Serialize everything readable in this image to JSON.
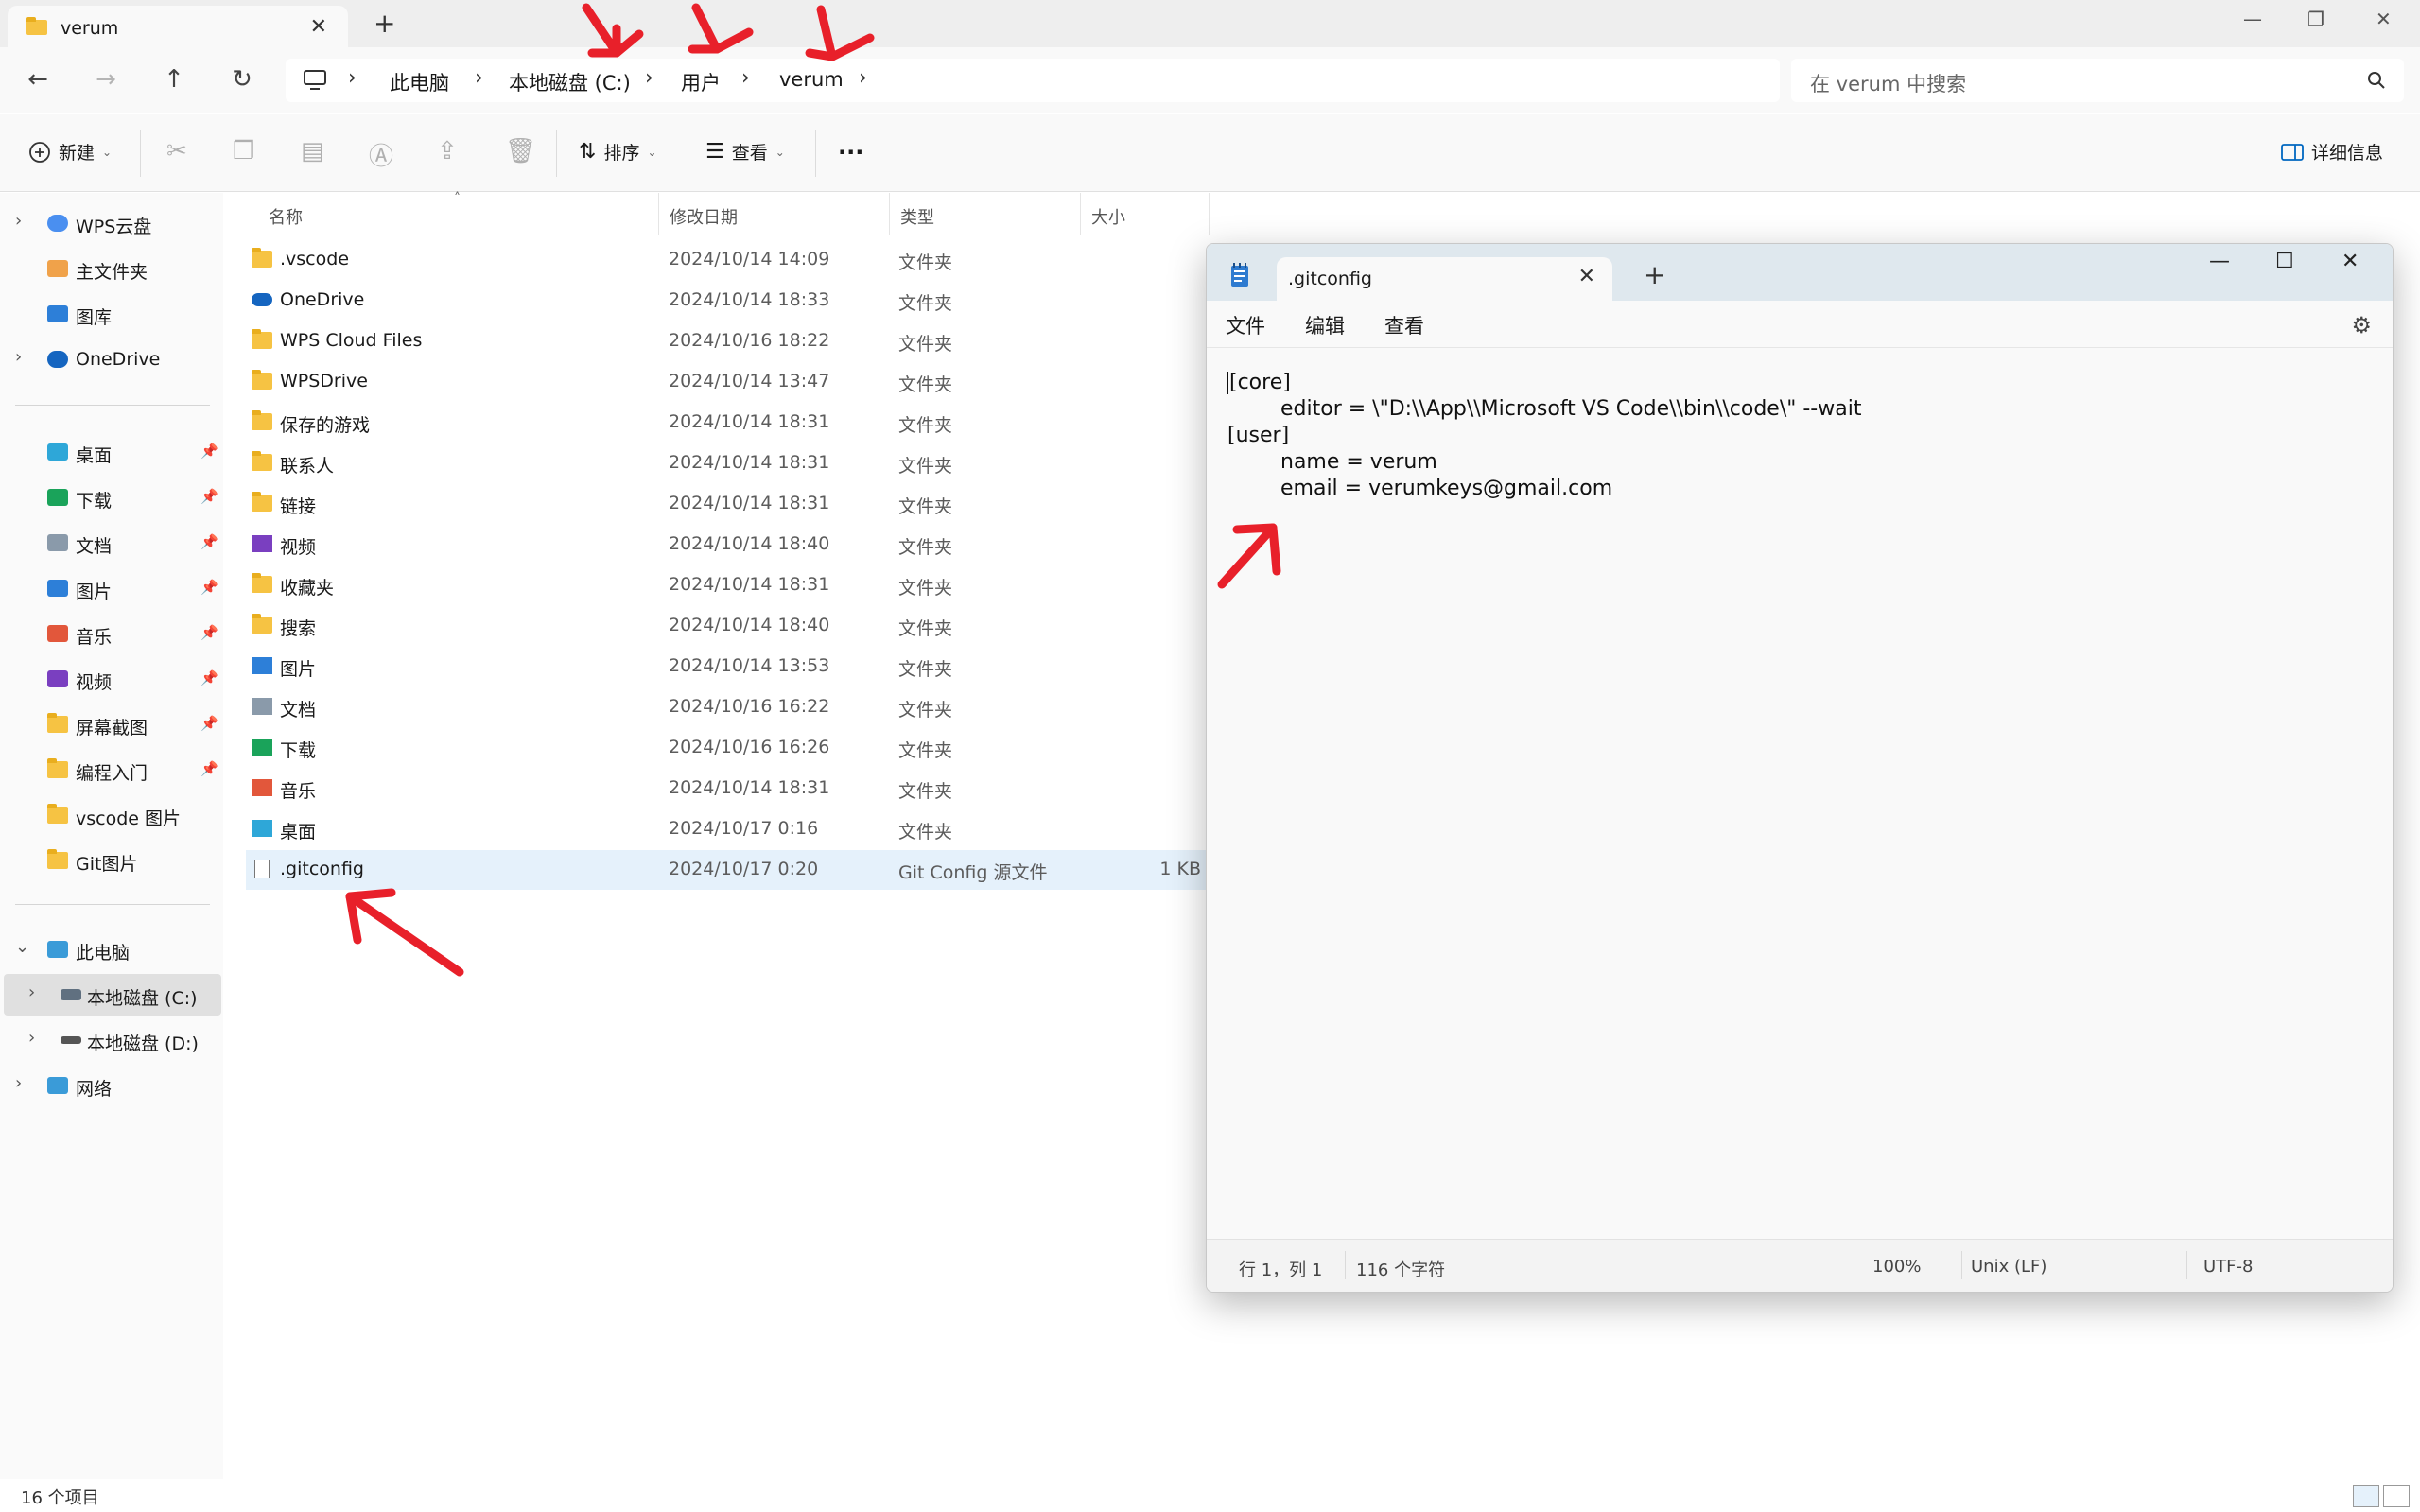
{
  "window": {
    "tab_title": "verum",
    "tab_close": "✕",
    "new_tab": "+",
    "minimize": "—",
    "restore": "❐",
    "close": "✕"
  },
  "nav": {
    "back": "←",
    "forward": "→",
    "up": "↑",
    "refresh": "↻"
  },
  "breadcrumb": [
    "此电脑",
    "本地磁盘 (C:)",
    "用户",
    "verum"
  ],
  "search": {
    "placeholder": "在 verum 中搜索"
  },
  "commandbar": {
    "new_label": "新建",
    "sort_label": "排序",
    "view_label": "查看",
    "more": "···",
    "details_label": "详细信息"
  },
  "sidebar": {
    "top": [
      {
        "label": "WPS云盘",
        "expand": true,
        "icon": "cloud-icon"
      },
      {
        "label": "主文件夹",
        "expand": false,
        "icon": "home-icon"
      },
      {
        "label": "图库",
        "expand": false,
        "icon": "gallery-icon"
      },
      {
        "label": "OneDrive",
        "expand": true,
        "icon": "onedrive-icon"
      }
    ],
    "quick": [
      {
        "label": "桌面",
        "icon": "desktop-icon",
        "pinned": true
      },
      {
        "label": "下载",
        "icon": "download-icon",
        "pinned": true
      },
      {
        "label": "文档",
        "icon": "document-icon",
        "pinned": true
      },
      {
        "label": "图片",
        "icon": "picture-icon",
        "pinned": true
      },
      {
        "label": "音乐",
        "icon": "music-icon",
        "pinned": true
      },
      {
        "label": "视频",
        "icon": "video-icon",
        "pinned": true
      },
      {
        "label": "屏幕截图",
        "icon": "folder-icon",
        "pinned": true
      },
      {
        "label": "编程入门",
        "icon": "folder-icon",
        "pinned": true
      },
      {
        "label": "vscode 图片",
        "icon": "folder-icon",
        "pinned": false
      },
      {
        "label": "Git图片",
        "icon": "folder-icon",
        "pinned": false
      }
    ],
    "pc": {
      "label": "此电脑"
    },
    "drive_c": {
      "label": "本地磁盘 (C:)"
    },
    "drive_d": {
      "label": "本地磁盘 (D:)"
    },
    "network": {
      "label": "网络"
    }
  },
  "columns": {
    "name": "名称",
    "modified": "修改日期",
    "type": "类型",
    "size": "大小"
  },
  "files": [
    {
      "name": ".vscode",
      "date": "2024/10/14 14:09",
      "type": "文件夹",
      "size": "",
      "icon": "folder-icon"
    },
    {
      "name": "OneDrive",
      "date": "2024/10/14 18:33",
      "type": "文件夹",
      "size": "",
      "icon": "onedrive-icon"
    },
    {
      "name": "WPS Cloud Files",
      "date": "2024/10/16 18:22",
      "type": "文件夹",
      "size": "",
      "icon": "folder-icon"
    },
    {
      "name": "WPSDrive",
      "date": "2024/10/14 13:47",
      "type": "文件夹",
      "size": "",
      "icon": "folder-icon"
    },
    {
      "name": "保存的游戏",
      "date": "2024/10/14 18:31",
      "type": "文件夹",
      "size": "",
      "icon": "folder-icon"
    },
    {
      "name": "联系人",
      "date": "2024/10/14 18:31",
      "type": "文件夹",
      "size": "",
      "icon": "folder-icon"
    },
    {
      "name": "链接",
      "date": "2024/10/14 18:31",
      "type": "文件夹",
      "size": "",
      "icon": "folder-icon"
    },
    {
      "name": "视频",
      "date": "2024/10/14 18:40",
      "type": "文件夹",
      "size": "",
      "icon": "video-icon"
    },
    {
      "name": "收藏夹",
      "date": "2024/10/14 18:31",
      "type": "文件夹",
      "size": "",
      "icon": "folder-icon"
    },
    {
      "name": "搜索",
      "date": "2024/10/14 18:40",
      "type": "文件夹",
      "size": "",
      "icon": "folder-icon"
    },
    {
      "name": "图片",
      "date": "2024/10/14 13:53",
      "type": "文件夹",
      "size": "",
      "icon": "picture-icon"
    },
    {
      "name": "文档",
      "date": "2024/10/16 16:22",
      "type": "文件夹",
      "size": "",
      "icon": "document-icon"
    },
    {
      "name": "下载",
      "date": "2024/10/16 16:26",
      "type": "文件夹",
      "size": "",
      "icon": "download-icon"
    },
    {
      "name": "音乐",
      "date": "2024/10/14 18:31",
      "type": "文件夹",
      "size": "",
      "icon": "music-icon"
    },
    {
      "name": "桌面",
      "date": "2024/10/17 0:16",
      "type": "文件夹",
      "size": "",
      "icon": "desktop-icon"
    },
    {
      "name": ".gitconfig",
      "date": "2024/10/17 0:20",
      "type": "Git Config 源文件",
      "size": "1 KB",
      "icon": "config-file-icon",
      "selected": true
    }
  ],
  "status": {
    "item_count": "16 个项目"
  },
  "notepad": {
    "tab_title": ".gitconfig",
    "tab_close": "✕",
    "new_tab": "+",
    "minimize": "—",
    "maximize": "☐",
    "close": "✕",
    "menu": [
      "文件",
      "编辑",
      "查看"
    ],
    "content": [
      "[core]",
      "\teditor = \\\"D:\\\\App\\\\Microsoft VS Code\\\\bin\\\\code\\\" --wait",
      "[user]",
      "\tname = verum",
      "\temail = verumkeys@gmail.com"
    ],
    "status": {
      "position": "行 1，列 1",
      "chars": "116 个字符",
      "zoom": "100%",
      "eol": "Unix (LF)",
      "encoding": "UTF-8"
    }
  },
  "colors": {
    "accent": "#0067c0",
    "selection": "#e5f1fb",
    "folder": "#f6c343",
    "annotation_red": "#e8202a"
  }
}
